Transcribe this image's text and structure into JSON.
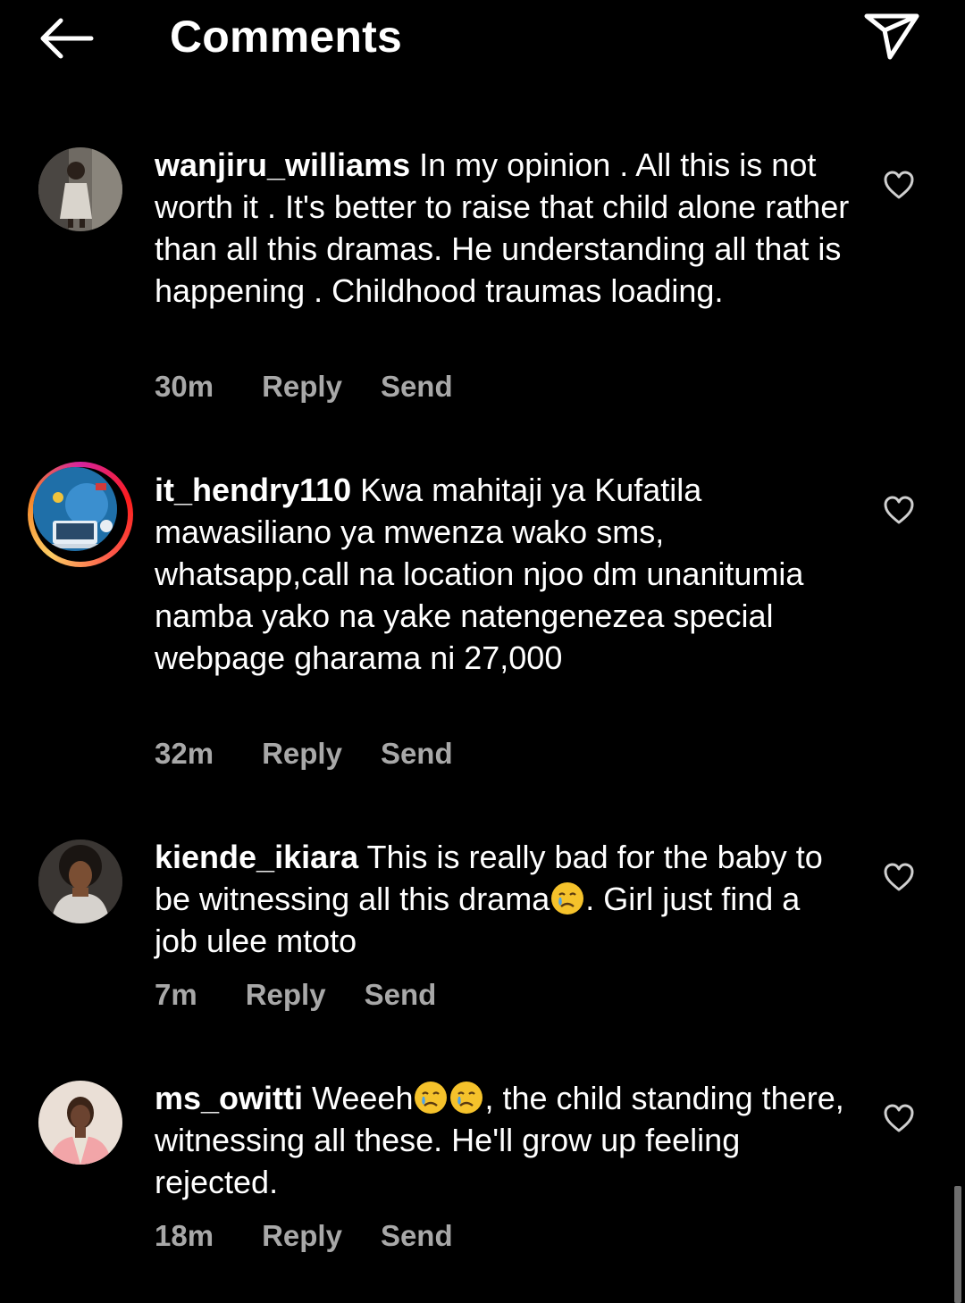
{
  "header": {
    "title": "Comments",
    "back_icon": "arrow-left-icon",
    "share_icon": "send-paper-plane-icon"
  },
  "comments": [
    {
      "username": "wanjiru_williams",
      "text": "In my opinion . All this is not worth it . It's better to raise that child alone rather than all this dramas. He  understanding all that is happening . Childhood traumas loading.",
      "time": "30m",
      "reply_label": "Reply",
      "send_label": "Send",
      "has_story_ring": false
    },
    {
      "username": "it_hendry110",
      "text": "Kwa mahitaji ya Kufatila mawasiliano ya mwenza wako sms, whatsapp,call na location njoo dm unanitumia namba yako na yake natengenezea special webpage gharama ni 27,000",
      "time": "32m",
      "reply_label": "Reply",
      "send_label": "Send",
      "has_story_ring": true
    },
    {
      "username": "kiende_ikiara",
      "text_before": "This is really bad for the baby to be witnessing all this drama",
      "text_after": ". Girl just find a job ulee mtoto",
      "emoji_count": 1,
      "time": "7m",
      "reply_label": "Reply",
      "send_label": "Send",
      "has_story_ring": false
    },
    {
      "username": "ms_owitti",
      "text_before": "Weeeh",
      "text_after": ", the child standing there, witnessing all these. He'll grow up feeling rejected.",
      "emoji_count": 2,
      "time": "18m",
      "reply_label": "Reply",
      "send_label": "Send",
      "has_story_ring": false
    }
  ],
  "icons": {
    "like": "heart-outline-icon",
    "emoji": "crying-face-emoji"
  },
  "colors": {
    "background": "#000000",
    "text": "#ffffff",
    "meta_text": "#a8a8a8"
  }
}
